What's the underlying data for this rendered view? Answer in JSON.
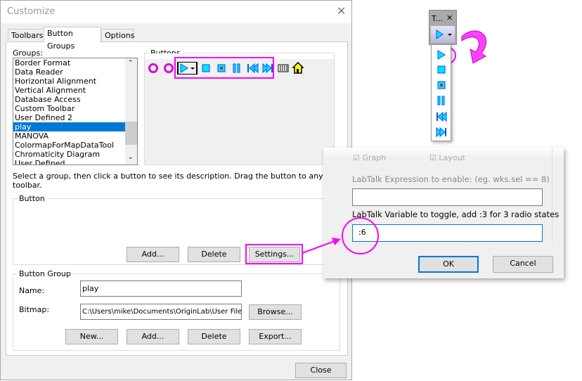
{
  "dialog": {
    "title": "Customize",
    "tabs": [
      "Toolbars",
      "Button Groups",
      "Options"
    ],
    "groups_label": "Groups:",
    "groups": [
      "Border Format",
      "Data Reader",
      "Horizontal Alignment",
      "Vertical Alignment",
      "Database Access",
      "Custom Toolbar",
      "User Defined 2",
      "play",
      "MANOVA",
      "ColormapForMapDataTool",
      "Chromaticity Diagram",
      "User Defined"
    ],
    "selected_group": "play",
    "buttons_label": "Buttons",
    "buttons_icons": [
      "down-arrow-circle-icon",
      "down-arrow-circle-icon",
      "play-dropdown-icon",
      "stop-icon",
      "record-icon",
      "pause-icon",
      "rewind-icon",
      "fast-forward-icon",
      "equalizer-icon",
      "house-icon"
    ],
    "hint": "Select a group, then click a button to see its description. Drag the button to any toolbar.",
    "button_section": {
      "label": "Button",
      "add": "Add...",
      "delete": "Delete",
      "settings": "Settings..."
    },
    "group_section": {
      "label": "Button Group",
      "name_label": "Name:",
      "name_value": "play",
      "bitmap_label": "Bitmap:",
      "bitmap_value": "C:\\Users\\mike\\Documents\\OriginLab\\User File",
      "browse": "Browse...",
      "new": "New...",
      "add": "Add...",
      "delete": "Delete",
      "export": "Export..."
    },
    "close": "Close"
  },
  "settings": {
    "graph": "Graph",
    "layout": "Layout",
    "expr_label": "LabTalk Expression to enable: (eg. wks.sel == 8)",
    "expr_value": "",
    "var_label": "LabTalk Variable to toggle, add :3 for 3 radio states",
    "var_value": ":6",
    "ok": "OK",
    "cancel": "Cancel"
  },
  "toolbar": {
    "title": "T...",
    "close": "✕",
    "items": [
      "play-icon",
      "stop-icon",
      "record-icon",
      "pause-icon",
      "rewind-icon",
      "fast-forward-icon"
    ]
  },
  "colors": {
    "highlight": "#ff00ff",
    "selection": "#0078d7",
    "icon": "#00e5ff"
  }
}
